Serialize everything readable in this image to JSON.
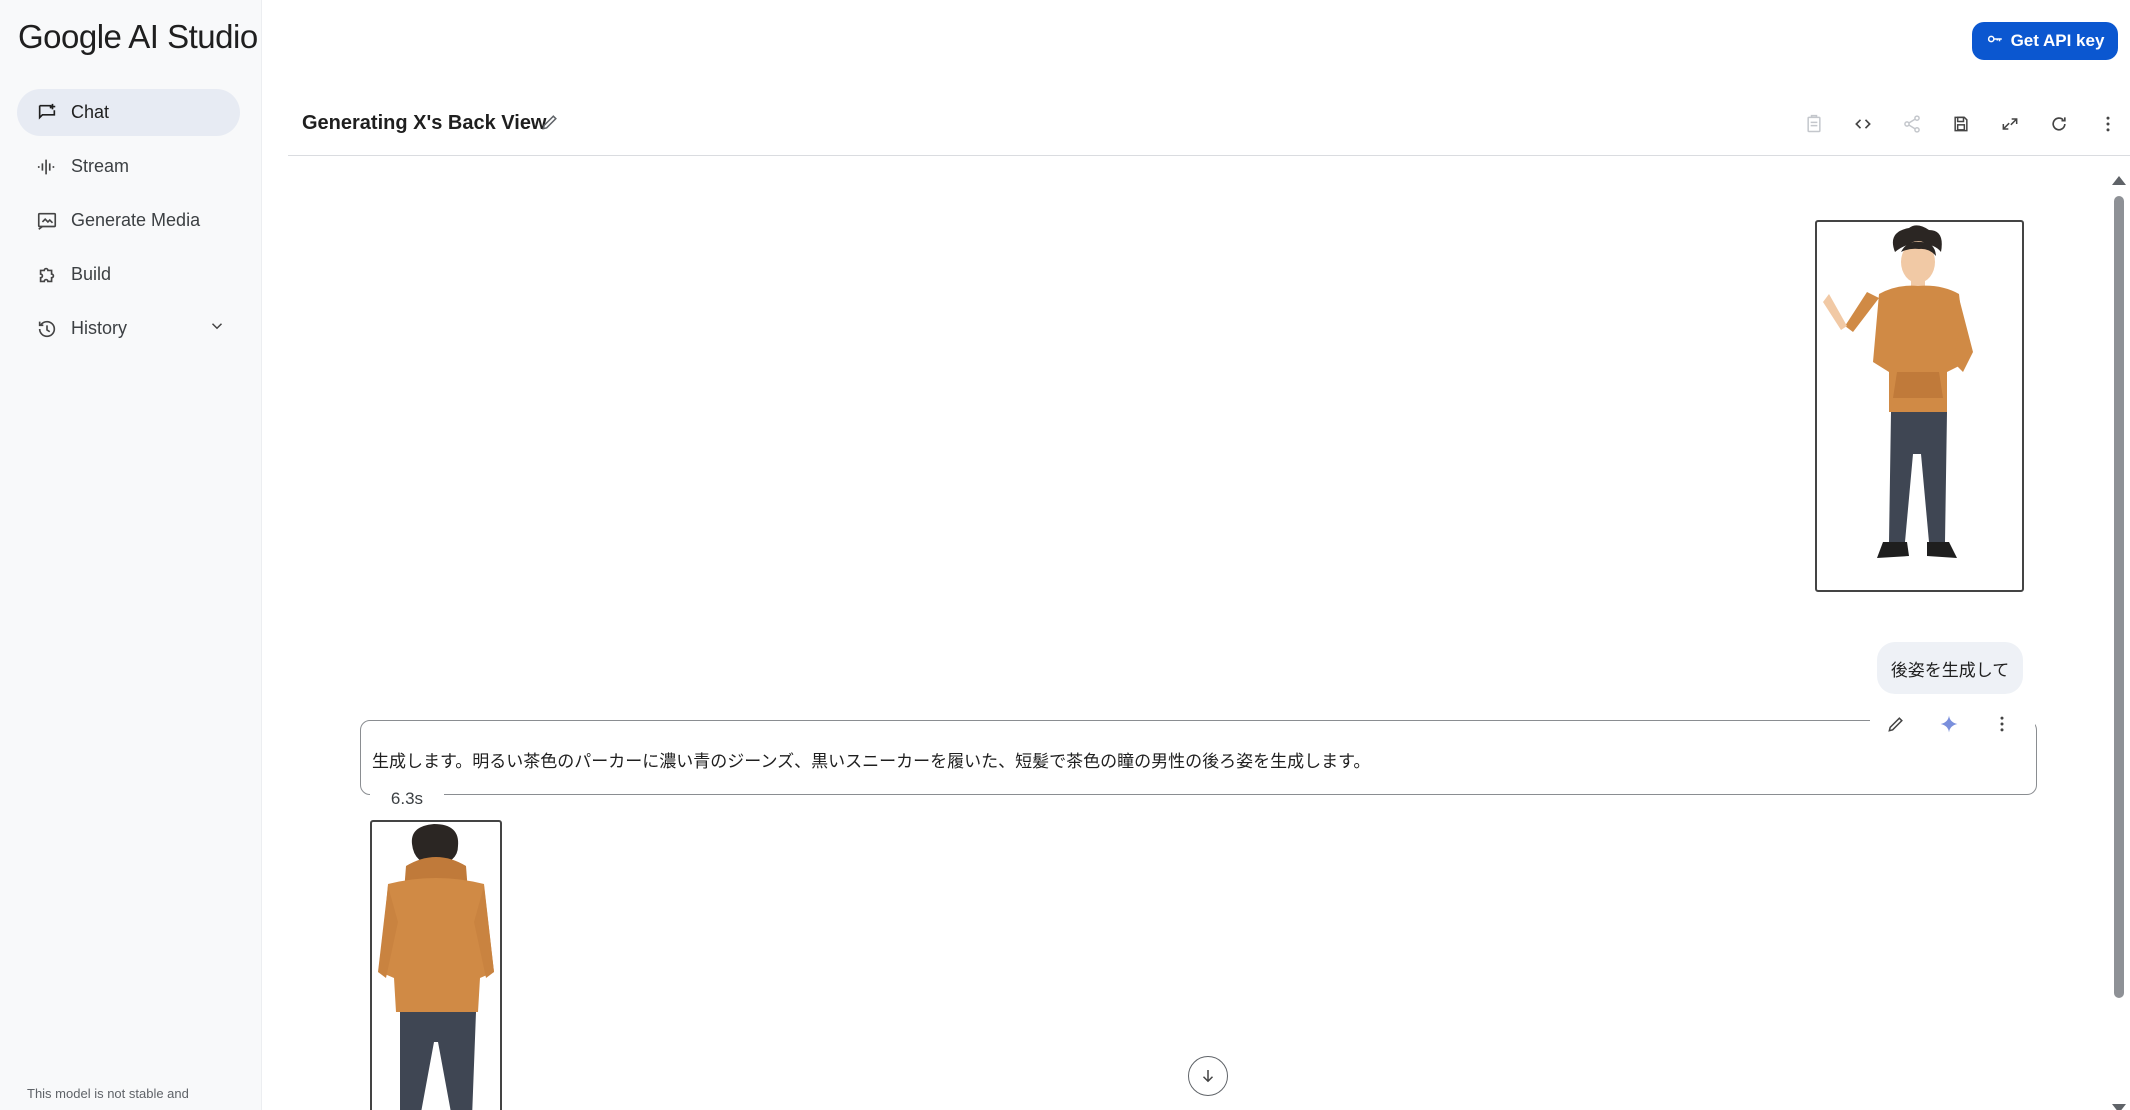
{
  "app": {
    "logo": "Google AI Studio"
  },
  "sidebar": {
    "items": [
      {
        "label": "Chat",
        "icon": "chat-icon",
        "active": true
      },
      {
        "label": "Stream",
        "icon": "waveform-icon"
      },
      {
        "label": "Generate Media",
        "icon": "media-icon"
      },
      {
        "label": "Build",
        "icon": "puzzle-icon"
      },
      {
        "label": "History",
        "icon": "history-icon"
      }
    ],
    "footer": "This model is not stable and"
  },
  "header": {
    "api_key_label": "Get API key",
    "title": "Generating X's Back View",
    "toolbar_icons": [
      "clipboard-icon",
      "code-icon",
      "share-icon",
      "save-icon",
      "compare-icon",
      "refresh-icon",
      "more-icon"
    ]
  },
  "chat": {
    "user_prompt": "後姿を生成して",
    "model_response": "生成します。明るい茶色のパーカーに濃い青のジーンズ、黒いスニーカーを履いた、短髪で茶色の瞳の男性の後ろ姿を生成します。",
    "response_time": "6.3s"
  },
  "colors": {
    "accent": "#0b57d0",
    "hoodie": "#d08a45",
    "jeans": "#3f4653",
    "hair": "#2b2623",
    "skin": "#f1c9a5"
  }
}
